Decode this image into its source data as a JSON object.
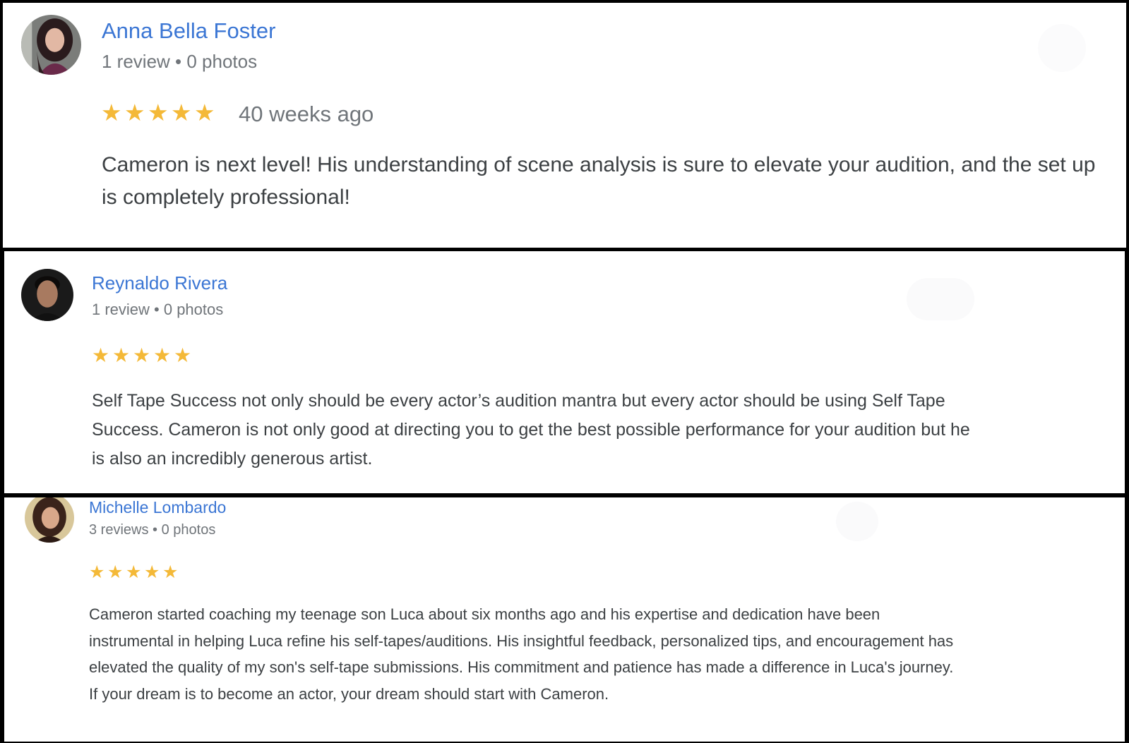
{
  "colors": {
    "name_link": "#3b76d4",
    "meta_text": "#70757a",
    "star": "#f4b938",
    "body_text": "#3c4043",
    "panel_border": "#000000",
    "panel_bg": "#ffffff"
  },
  "reviews": [
    {
      "reviewer_name": "Anna Bella Foster",
      "reviewer_meta": "1 review • 0 photos",
      "rating": 5,
      "rating_stars": "★★★★★",
      "date": "40 weeks ago",
      "text": "Cameron is next level! His understanding of scene analysis is sure to elevate your audition, and the set up is completely professional!",
      "avatar_icon": "profile-photo",
      "menu_icon": "more-options-icon"
    },
    {
      "reviewer_name": "Reynaldo Rivera",
      "reviewer_meta": "1 review • 0 photos",
      "rating": 5,
      "rating_stars": "★★★★★",
      "date": "",
      "text": "Self Tape Success not only should be every actor’s audition mantra but every actor should be using Self Tape Success. Cameron is not only good at directing you to get the best possible performance for your audition but he is also an incredibly generous artist.",
      "avatar_icon": "profile-photo",
      "menu_icon": "more-options-icon"
    },
    {
      "reviewer_name": "Michelle Lombardo",
      "reviewer_meta": "3 reviews • 0 photos",
      "rating": 5,
      "rating_stars": "★★★★★",
      "date": "",
      "text": "Cameron started coaching my teenage son Luca about six months ago and his expertise and dedication have been instrumental in helping Luca refine his self-tapes/auditions. His insightful feedback, personalized tips, and encouragement has elevated the quality of my son's self-tape submissions. His commitment and patience has made a difference in Luca's journey. If your dream is to become an actor, your dream should start with Cameron.",
      "avatar_icon": "profile-photo",
      "menu_icon": "more-options-icon"
    }
  ]
}
